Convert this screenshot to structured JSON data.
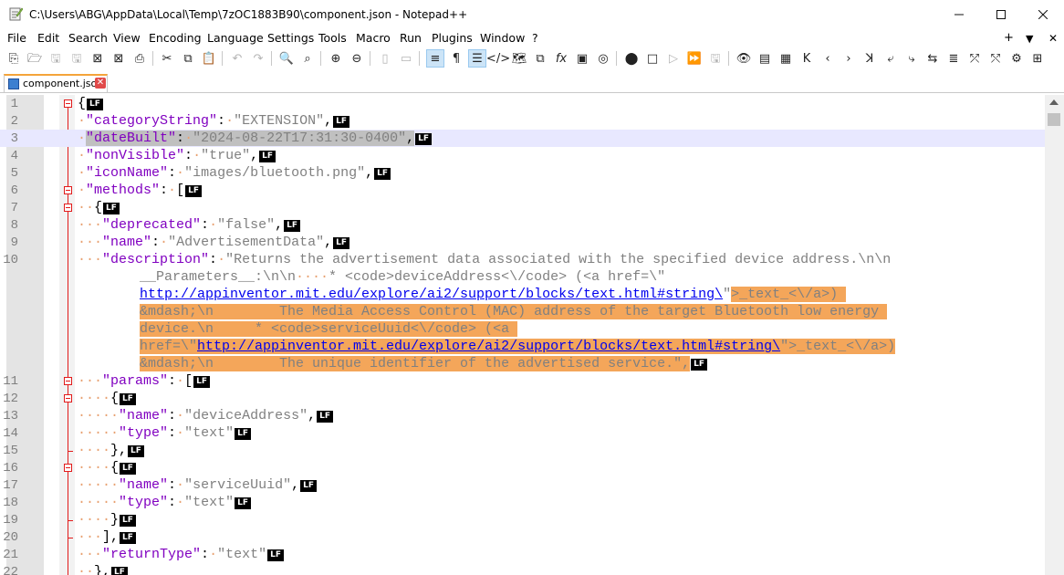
{
  "window": {
    "title": "C:\\Users\\ABG\\AppData\\Local\\Temp\\7zOC1883B90\\component.json - Notepad++",
    "minimize_icon": "minimize-icon",
    "maximize_icon": "maximize-icon",
    "close_icon": "close-icon"
  },
  "menubar": {
    "items": [
      "File",
      "Edit",
      "Search",
      "View",
      "Encoding",
      "Language",
      "Settings",
      "Tools",
      "Macro",
      "Run",
      "Plugins",
      "Window",
      "?"
    ],
    "right_plus": "+",
    "right_dropdown": "▼",
    "right_close": "✕"
  },
  "tab": {
    "label": "component.json",
    "close_glyph": "✕"
  },
  "editor": {
    "lf_badge": "LF",
    "lines": [
      {
        "n": "1"
      },
      {
        "n": "2"
      },
      {
        "n": "3"
      },
      {
        "n": "4"
      },
      {
        "n": "5"
      },
      {
        "n": "6"
      },
      {
        "n": "7"
      },
      {
        "n": "8"
      },
      {
        "n": "9"
      },
      {
        "n": "10"
      },
      {
        "n": "11"
      },
      {
        "n": "12"
      },
      {
        "n": "13"
      },
      {
        "n": "14"
      },
      {
        "n": "15"
      },
      {
        "n": "16"
      },
      {
        "n": "17"
      },
      {
        "n": "18"
      },
      {
        "n": "19"
      },
      {
        "n": "20"
      },
      {
        "n": "21"
      },
      {
        "n": "22"
      }
    ],
    "keys": {
      "categoryString": "\"categoryString\"",
      "dateBuilt": "\"dateBuilt\"",
      "nonVisible": "\"nonVisible\"",
      "iconName": "\"iconName\"",
      "methods": "\"methods\"",
      "deprecated": "\"deprecated\"",
      "name": "\"name\"",
      "description": "\"description\"",
      "params": "\"params\"",
      "type": "\"type\"",
      "returnType": "\"returnType\""
    },
    "values": {
      "categoryString": "\"EXTENSION\"",
      "dateBuilt": "\"2024-08-22T17:31:30-0400\"",
      "nonVisible": "\"true\"",
      "iconName": "\"images/bluetooth.png\"",
      "deprecated": "\"false\"",
      "name": "\"AdvertisementData\"",
      "desc_1": "\"Returns the advertisement data associated with the specified device address.\\n\\n",
      "desc_2": "__Parameters__:\\n\\n",
      "desc_2b": "* <code>deviceAddress<\\/code> (<a href=\\\"",
      "desc_3_link": "http://appinventor.mit.edu/explore/ai2/support/blocks/text.html#string\\",
      "desc_3_rest": "\"",
      "desc_3_sel": ">_text_<\\/a>) ",
      "desc_4": "&mdash;\\n        The Media Access Control (MAC) address of the target Bluetooth low energy ",
      "desc_5": "device.\\n     * <code>serviceUuid<\\/code> (<a ",
      "desc_6a": "href=\\\"",
      "desc_6_link": "http://appinventor.mit.edu/explore/ai2/support/blocks/text.html#string\\",
      "desc_6b": "\">_text_<\\/a>)",
      "desc_7": "&mdash;\\n        The unique identifier of the advertised service.\",",
      "deviceAddress": "\"deviceAddress\"",
      "text": "\"text\"",
      "serviceUuid": "\"serviceUuid\"",
      "returnType": "\"text\""
    }
  }
}
